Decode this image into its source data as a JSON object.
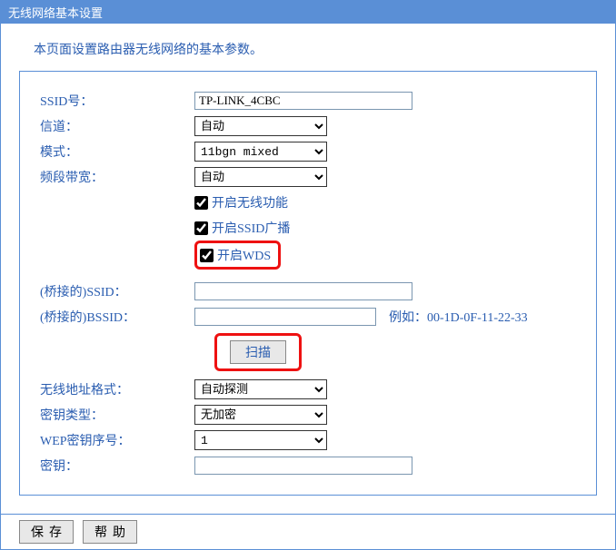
{
  "title": "无线网络基本设置",
  "description": "本页面设置路由器无线网络的基本参数。",
  "form": {
    "ssid_label": "SSID号：",
    "ssid_value": "TP-LINK_4CBC",
    "channel_label": "信道：",
    "channel_value": "自动",
    "mode_label": "模式：",
    "mode_value": "11bgn mixed",
    "bandwidth_label": "频段带宽：",
    "bandwidth_value": "自动",
    "cb_wireless": "开启无线功能",
    "cb_ssid_broadcast": "开启SSID广播",
    "cb_wds": "开启WDS",
    "bridge_ssid_label": "(桥接的)SSID：",
    "bridge_ssid_value": "",
    "bridge_bssid_label": "(桥接的)BSSID：",
    "bridge_bssid_value": "",
    "bssid_example": "例如：00-1D-0F-11-22-33",
    "scan_label": "扫描",
    "addr_format_label": "无线地址格式：",
    "addr_format_value": "自动探测",
    "key_type_label": "密钥类型：",
    "key_type_value": "无加密",
    "wep_index_label": "WEP密钥序号：",
    "wep_index_value": "1",
    "key_label": "密钥：",
    "key_value": ""
  },
  "footer": {
    "save": "保存",
    "help": "帮助"
  }
}
